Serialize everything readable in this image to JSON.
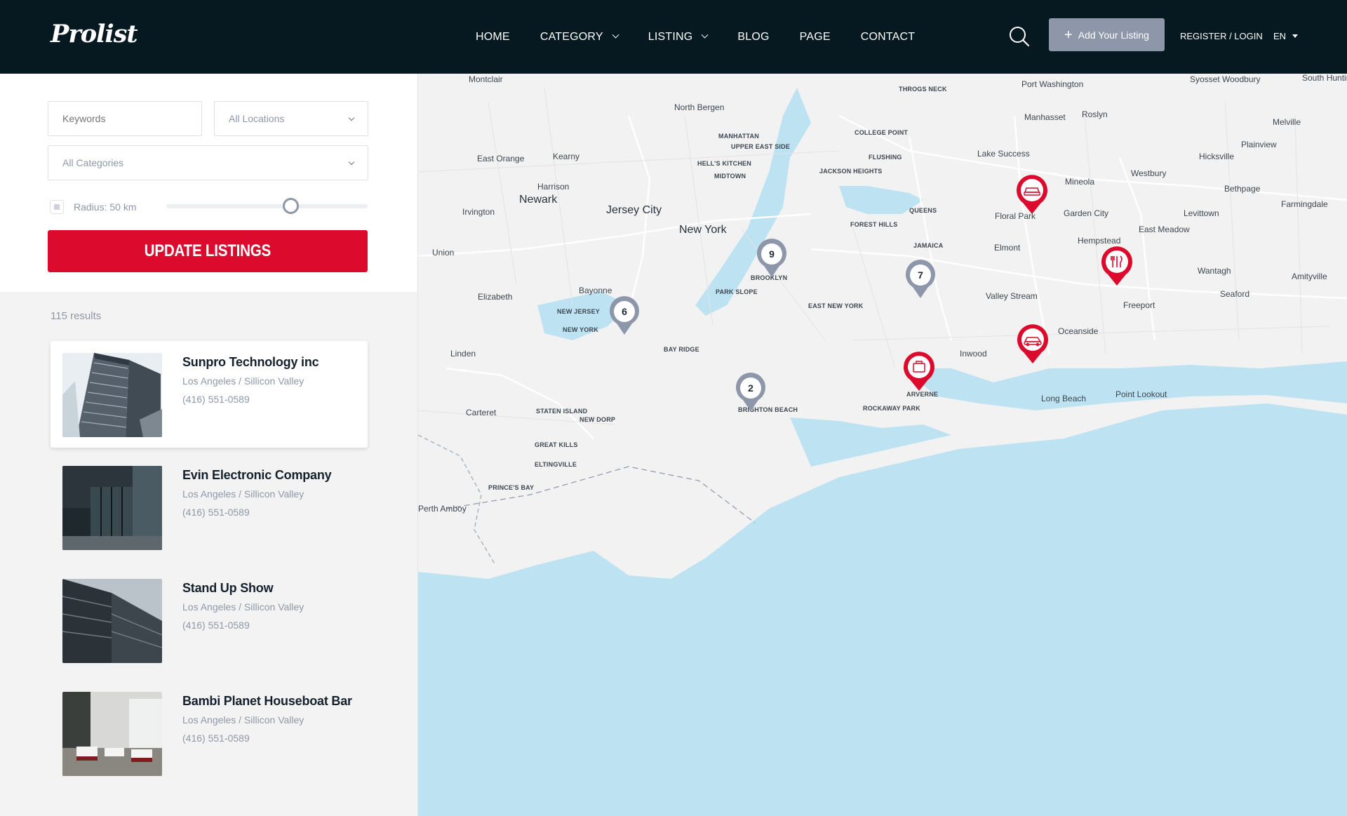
{
  "brand": {
    "logo": "Prolist",
    "accent": "#dc0a2c",
    "header_bg": "#061920"
  },
  "nav": {
    "items": [
      {
        "label": "HOME"
      },
      {
        "label": "CATEGORY",
        "dropdown": true
      },
      {
        "label": "LISTING",
        "dropdown": true
      },
      {
        "label": "BLOG"
      },
      {
        "label": "PAGE"
      },
      {
        "label": "CONTACT"
      }
    ],
    "search_icon": "search-icon",
    "add_listing": "Add Your Listing",
    "register_login": "REGISTER / LOGIN",
    "language": "EN"
  },
  "filters": {
    "keywords_placeholder": "Keywords",
    "location_value": "All Locations",
    "category_value": "All Categories",
    "radius_label": "Radius: 50 km",
    "radius_value_fraction": 0.62,
    "update_button": "UPDATE LISTINGS"
  },
  "results": {
    "count_text": "115 results",
    "items": [
      {
        "title": "Sunpro Technology inc",
        "location": "Los Angeles /  Sillicon Valley",
        "phone": "(416) 551-0589"
      },
      {
        "title": "Evin Electronic Company",
        "location": "Los Angeles /  Sillicon Valley",
        "phone": "(416) 551-0589"
      },
      {
        "title": "Stand Up Show",
        "location": "Los Angeles /  Sillicon Valley",
        "phone": "(416) 551-0589"
      },
      {
        "title": "Bambi Planet Houseboat Bar",
        "location": "Los Angeles /  Sillicon Valley",
        "phone": "(416) 551-0589"
      }
    ]
  },
  "map": {
    "labels": [
      "Montclair",
      "North Bergen",
      "MANHATTAN",
      "UPPER EAST SIDE",
      "HELL'S KITCHEN",
      "MIDTOWN",
      "East Orange",
      "Kearny",
      "Harrison",
      "Newark",
      "Irvington",
      "Jersey City",
      "New York",
      "Union",
      "Bayonne",
      "Elizabeth",
      "NEW JERSEY",
      "NEW YORK",
      "Linden",
      "Carteret",
      "STATEN ISLAND",
      "NEW DORP",
      "GREAT KILLS",
      "ELTINGVILLE",
      "PRINCE'S BAY",
      "Perth Amboy",
      "BROOKLYN",
      "PARK SLOPE",
      "BAY RIDGE",
      "BRIGHTON BEACH",
      "QUEENS",
      "FOREST HILLS",
      "JAMAICA",
      "EAST NEW YORK",
      "ARVERNE",
      "ROCKAWAY PARK",
      "COLLEGE POINT",
      "FLUSHING",
      "JACKSON HEIGHTS",
      "THROGS NECK",
      "Port Washington",
      "Manhasset",
      "Roslyn",
      "Lake Success",
      "Mineola",
      "Floral Park",
      "Garden City",
      "Hempstead",
      "Elmont",
      "Valley Stream",
      "Inwood",
      "Oceanside",
      "Long Beach",
      "Point Lookout",
      "Freeport",
      "Westbury",
      "Hicksville",
      "Levittown",
      "East Meadow",
      "Wantagh",
      "Seaford",
      "Amityville",
      "Plainview",
      "Bethpage",
      "Farmingdale",
      "Syosset Woodbury",
      "Melville",
      "South Huntington"
    ],
    "clusters": [
      "9",
      "7",
      "6",
      "2"
    ],
    "pins": [
      "car-icon",
      "restaurant-icon",
      "car-icon",
      "briefcase-icon"
    ]
  }
}
